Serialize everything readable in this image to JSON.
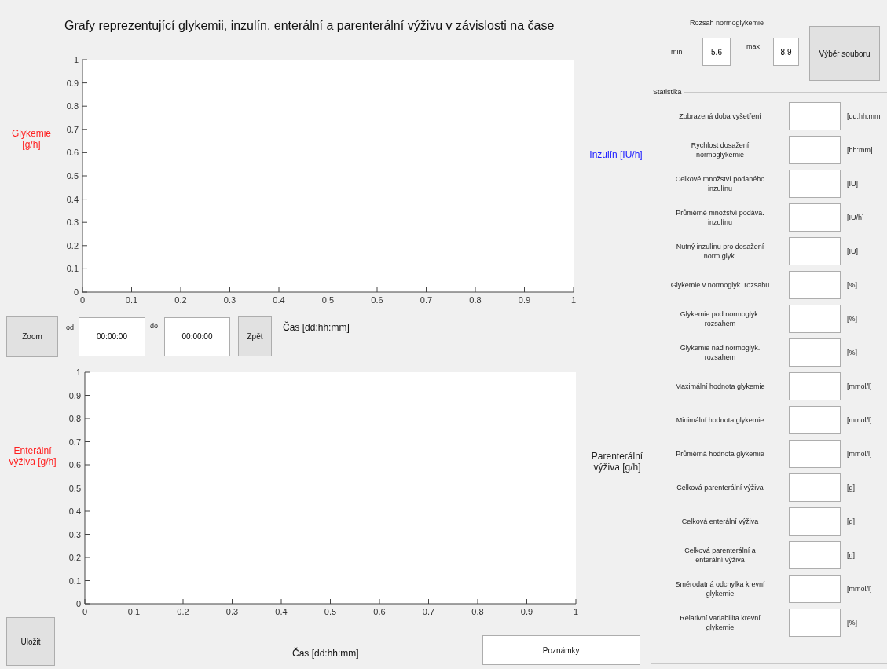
{
  "title": "Grafy reprezentující glykemii, inzulín, enterální a parenterální výživu v závislosti na čase",
  "charts": [
    {
      "right_label": "Inzulín [IU/h]",
      "chart_data": {
        "type": "line",
        "xlabel": "Čas [dd:hh:mm]",
        "ylabel": "Glykemie [g/h]",
        "xlim": [
          0,
          1
        ],
        "ylim": [
          0,
          1
        ],
        "xticks": [
          0,
          0.1,
          0.2,
          0.3,
          0.4,
          0.5,
          0.6,
          0.7,
          0.8,
          0.9,
          1
        ],
        "yticks": [
          0,
          0.1,
          0.2,
          0.3,
          0.4,
          0.5,
          0.6,
          0.7,
          0.8,
          0.9,
          1
        ]
      }
    },
    {
      "right_label": "Parenterální výživa [g/h]",
      "chart_data": {
        "type": "line",
        "xlabel": "Čas [dd:hh:mm]",
        "ylabel": "Enterální výživa [g/h]",
        "xlim": [
          0,
          1
        ],
        "ylim": [
          0,
          1
        ],
        "xticks": [
          0,
          0.1,
          0.2,
          0.3,
          0.4,
          0.5,
          0.6,
          0.7,
          0.8,
          0.9,
          1
        ],
        "yticks": [
          0,
          0.1,
          0.2,
          0.3,
          0.4,
          0.5,
          0.6,
          0.7,
          0.8,
          0.9,
          1
        ]
      }
    }
  ],
  "zoom": {
    "button": "Zoom",
    "from_label": "od",
    "from_value": "00:00:00",
    "to_label": "do",
    "to_value": "00:00:00",
    "back_button": "Zpět"
  },
  "save_button": "Uložit",
  "notes_button": "Poznámky",
  "range": {
    "title": "Rozsah normoglykemie",
    "min_label": "min",
    "min_value": "5.6",
    "max_label": "max",
    "max_value": "8.9"
  },
  "file_button": "Výběr souboru",
  "statistics": {
    "title": "Statistika",
    "rows": [
      {
        "label": "Zobrazená doba vyšetření",
        "unit": "[dd:hh:mm"
      },
      {
        "label": "Rychlost dosažení normoglykemie",
        "unit": "[hh:mm]"
      },
      {
        "label": "Celkové množství podaného inzulínu",
        "unit": "[IU]"
      },
      {
        "label": "Průměrné množství podáva. inzulínu",
        "unit": "[IU/h]"
      },
      {
        "label": "Nutný inzulínu pro dosažení norm.glyk.",
        "unit": "[IU]"
      },
      {
        "label": "Glykemie v normoglyk. rozsahu",
        "unit": "[%]"
      },
      {
        "label": "Glykemie pod normoglyk. rozsahem",
        "unit": "[%]"
      },
      {
        "label": "Glykemie nad normoglyk. rozsahem",
        "unit": "[%]"
      },
      {
        "label": "Maximální hodnota glykemie",
        "unit": "[mmol/l]"
      },
      {
        "label": "Minimální hodnota glykemie",
        "unit": "[mmol/l]"
      },
      {
        "label": "Průměrná hodnota glykemie",
        "unit": "[mmol/l]"
      },
      {
        "label": "Celková parenterální výživa",
        "unit": "[g]"
      },
      {
        "label": "Celková enterální výživa",
        "unit": "[g]"
      },
      {
        "label": "Celková parenterální a enterální výživa",
        "unit": "[g]"
      },
      {
        "label": "Směrodatná odchylka krevní glykemie",
        "unit": "[mmol/l]"
      },
      {
        "label": "Relativní variabilita krevní glykemie",
        "unit": "[%]"
      }
    ]
  }
}
